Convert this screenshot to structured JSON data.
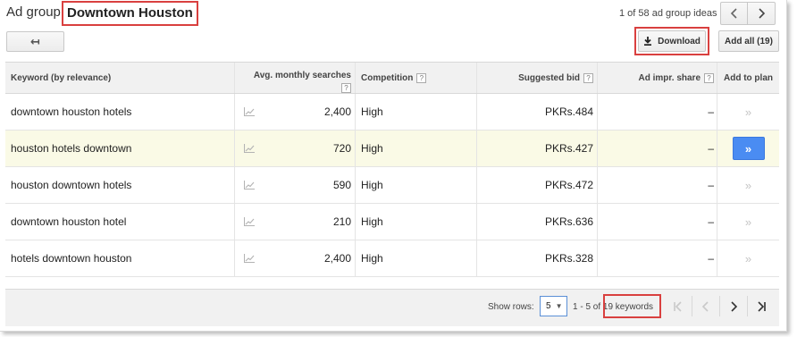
{
  "header": {
    "ad_group_label": "Ad group:",
    "ad_group_name": "Downtown Houston",
    "ideas_count": "1 of 58 ad group ideas",
    "prev_icon": "chevron-left-icon",
    "next_icon": "chevron-right-icon"
  },
  "toolbar": {
    "back_icon": "back-arrow-icon",
    "back_glyph": "↤",
    "download_label": "Download",
    "download_icon": "download-icon",
    "add_all_label": "Add all (19)"
  },
  "table": {
    "columns": {
      "keyword": "Keyword (by relevance)",
      "searches": "Avg. monthly searches",
      "competition": "Competition",
      "bid": "Suggested bid",
      "impr_share": "Ad impr. share",
      "add": "Add to plan"
    },
    "help_glyph": "?",
    "rows": [
      {
        "keyword": "downtown houston hotels",
        "searches": "2,400",
        "competition": "High",
        "bid": "PKRs.484",
        "impr_share": "–",
        "added": false
      },
      {
        "keyword": "houston hotels downtown",
        "searches": "720",
        "competition": "High",
        "bid": "PKRs.427",
        "impr_share": "–",
        "added": true
      },
      {
        "keyword": "houston downtown hotels",
        "searches": "590",
        "competition": "High",
        "bid": "PKRs.472",
        "impr_share": "–",
        "added": false
      },
      {
        "keyword": "downtown houston hotel",
        "searches": "210",
        "competition": "High",
        "bid": "PKRs.636",
        "impr_share": "–",
        "added": false
      },
      {
        "keyword": "hotels downtown houston",
        "searches": "2,400",
        "competition": "High",
        "bid": "PKRs.328",
        "impr_share": "–",
        "added": false
      }
    ]
  },
  "pagination": {
    "show_rows_label": "Show rows:",
    "rows_value": "5",
    "range_text": "1 - 5 of 19 keywords",
    "first_icon": "first-page-icon",
    "prev_icon": "prev-page-icon",
    "next_icon": "next-page-icon",
    "last_icon": "last-page-icon"
  },
  "colors": {
    "highlight_border": "#d9403f",
    "add_button": "#4a8cf2",
    "selected_row": "#fafae6"
  }
}
